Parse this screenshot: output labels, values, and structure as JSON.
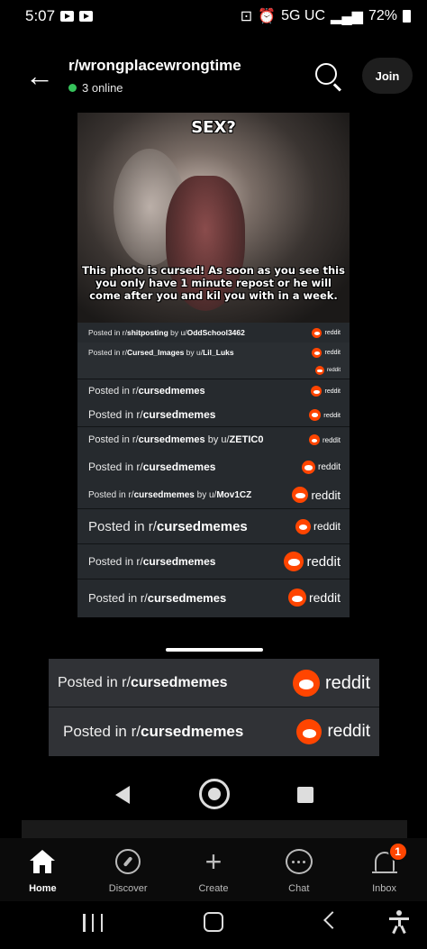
{
  "status_bar": {
    "time": "5:07",
    "network": "5G UC",
    "battery": "72%"
  },
  "header": {
    "subreddit": "r/wrongplacewrongtime",
    "online": "3 online",
    "join_label": "Join"
  },
  "meme": {
    "title": "SEX?",
    "caption": "This photo is cursed! As soon as you see this you only have 1 minute repost or he will come after you and kil you with in a week.",
    "rows": [
      {
        "prefix": "Posted in r/",
        "sub": "shitposting",
        "by": " by u/",
        "user": "OddSchool3462",
        "brand": "reddit"
      },
      {
        "prefix": "Posted in r/",
        "sub": "Cursed_Images",
        "by": " by u/",
        "user": "Lil_Luks",
        "brand": "reddit"
      },
      {
        "prefix": "",
        "sub": "",
        "by": "",
        "user": "",
        "brand": "reddit"
      },
      {
        "prefix": "Posted in r/",
        "sub": "cursedmemes",
        "by": "",
        "user": "",
        "brand": "reddit"
      },
      {
        "prefix": "Posted in r/",
        "sub": "cursedmemes",
        "by": "",
        "user": "",
        "brand": "reddit"
      },
      {
        "prefix": "Posted in r/",
        "sub": "cursedmemes",
        "by": " by u/",
        "user": "ZETIC0",
        "brand": "reddit"
      },
      {
        "prefix": "Posted in r/",
        "sub": "cursedmemes",
        "by": "",
        "user": "",
        "brand": "reddit"
      },
      {
        "prefix": "Posted in r/",
        "sub": "cursedmemes",
        "by": " by u/",
        "user": "Mov1CZ",
        "brand": "reddit"
      },
      {
        "prefix": "Posted in r/",
        "sub": "cursedmemes",
        "by": "",
        "user": "",
        "brand": "reddit"
      },
      {
        "prefix": "Posted in r/",
        "sub": "cursedmemes",
        "by": "",
        "user": "",
        "brand": "reddit"
      },
      {
        "prefix": "Posted in r/",
        "sub": "cursedmemes",
        "by": "",
        "user": "",
        "brand": "reddit"
      }
    ],
    "big_rows": [
      {
        "prefix": "Posted in r/",
        "sub": "cursedmemes",
        "brand": "reddit"
      },
      {
        "prefix": "Posted in r/",
        "sub": "cursedmemes",
        "brand": "reddit"
      }
    ]
  },
  "bottom_nav": {
    "items": [
      {
        "label": "Home",
        "icon": "home-icon"
      },
      {
        "label": "Discover",
        "icon": "compass-icon"
      },
      {
        "label": "Create",
        "icon": "plus-icon"
      },
      {
        "label": "Chat",
        "icon": "chat-icon"
      },
      {
        "label": "Inbox",
        "icon": "bell-icon"
      }
    ],
    "inbox_badge": "1"
  },
  "colors": {
    "accent": "#ff4500",
    "online": "#36c25b"
  }
}
